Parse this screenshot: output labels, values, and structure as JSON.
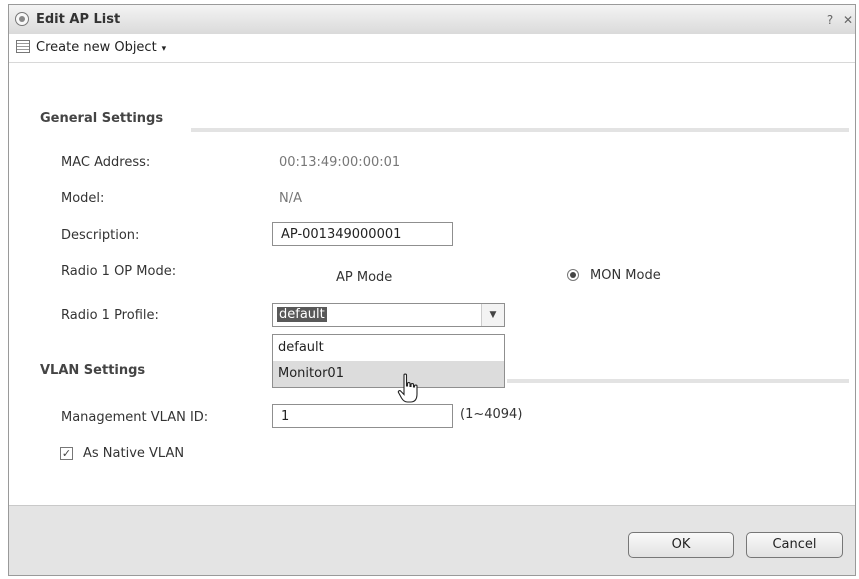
{
  "dialog": {
    "title": "Edit AP List",
    "help_icon": "?",
    "close_icon": "✕"
  },
  "toolbar": {
    "create_label": "Create new Object",
    "caret": "▾"
  },
  "general": {
    "title": "General Settings",
    "mac_label": "MAC Address:",
    "mac_value": "00:13:49:00:00:01",
    "model_label": "Model:",
    "model_value": "N/A",
    "description_label": "Description:",
    "description_value": "AP-001349000001",
    "radio_mode_label": "Radio 1 OP Mode:",
    "ap_mode_label": "AP Mode",
    "mon_mode_label": "MON Mode",
    "radio_profile_label": "Radio 1 Profile:",
    "radio_profile_value": "default",
    "radio_profile_options": [
      "default",
      "Monitor01"
    ]
  },
  "vlan": {
    "title": "VLAN Settings",
    "mgmt_label": "Management VLAN ID:",
    "mgmt_value": "1",
    "range_hint": "(1~4094)",
    "native_label": "As Native VLAN",
    "native_checked": true
  },
  "footer": {
    "ok_label": "OK",
    "cancel_label": "Cancel"
  }
}
